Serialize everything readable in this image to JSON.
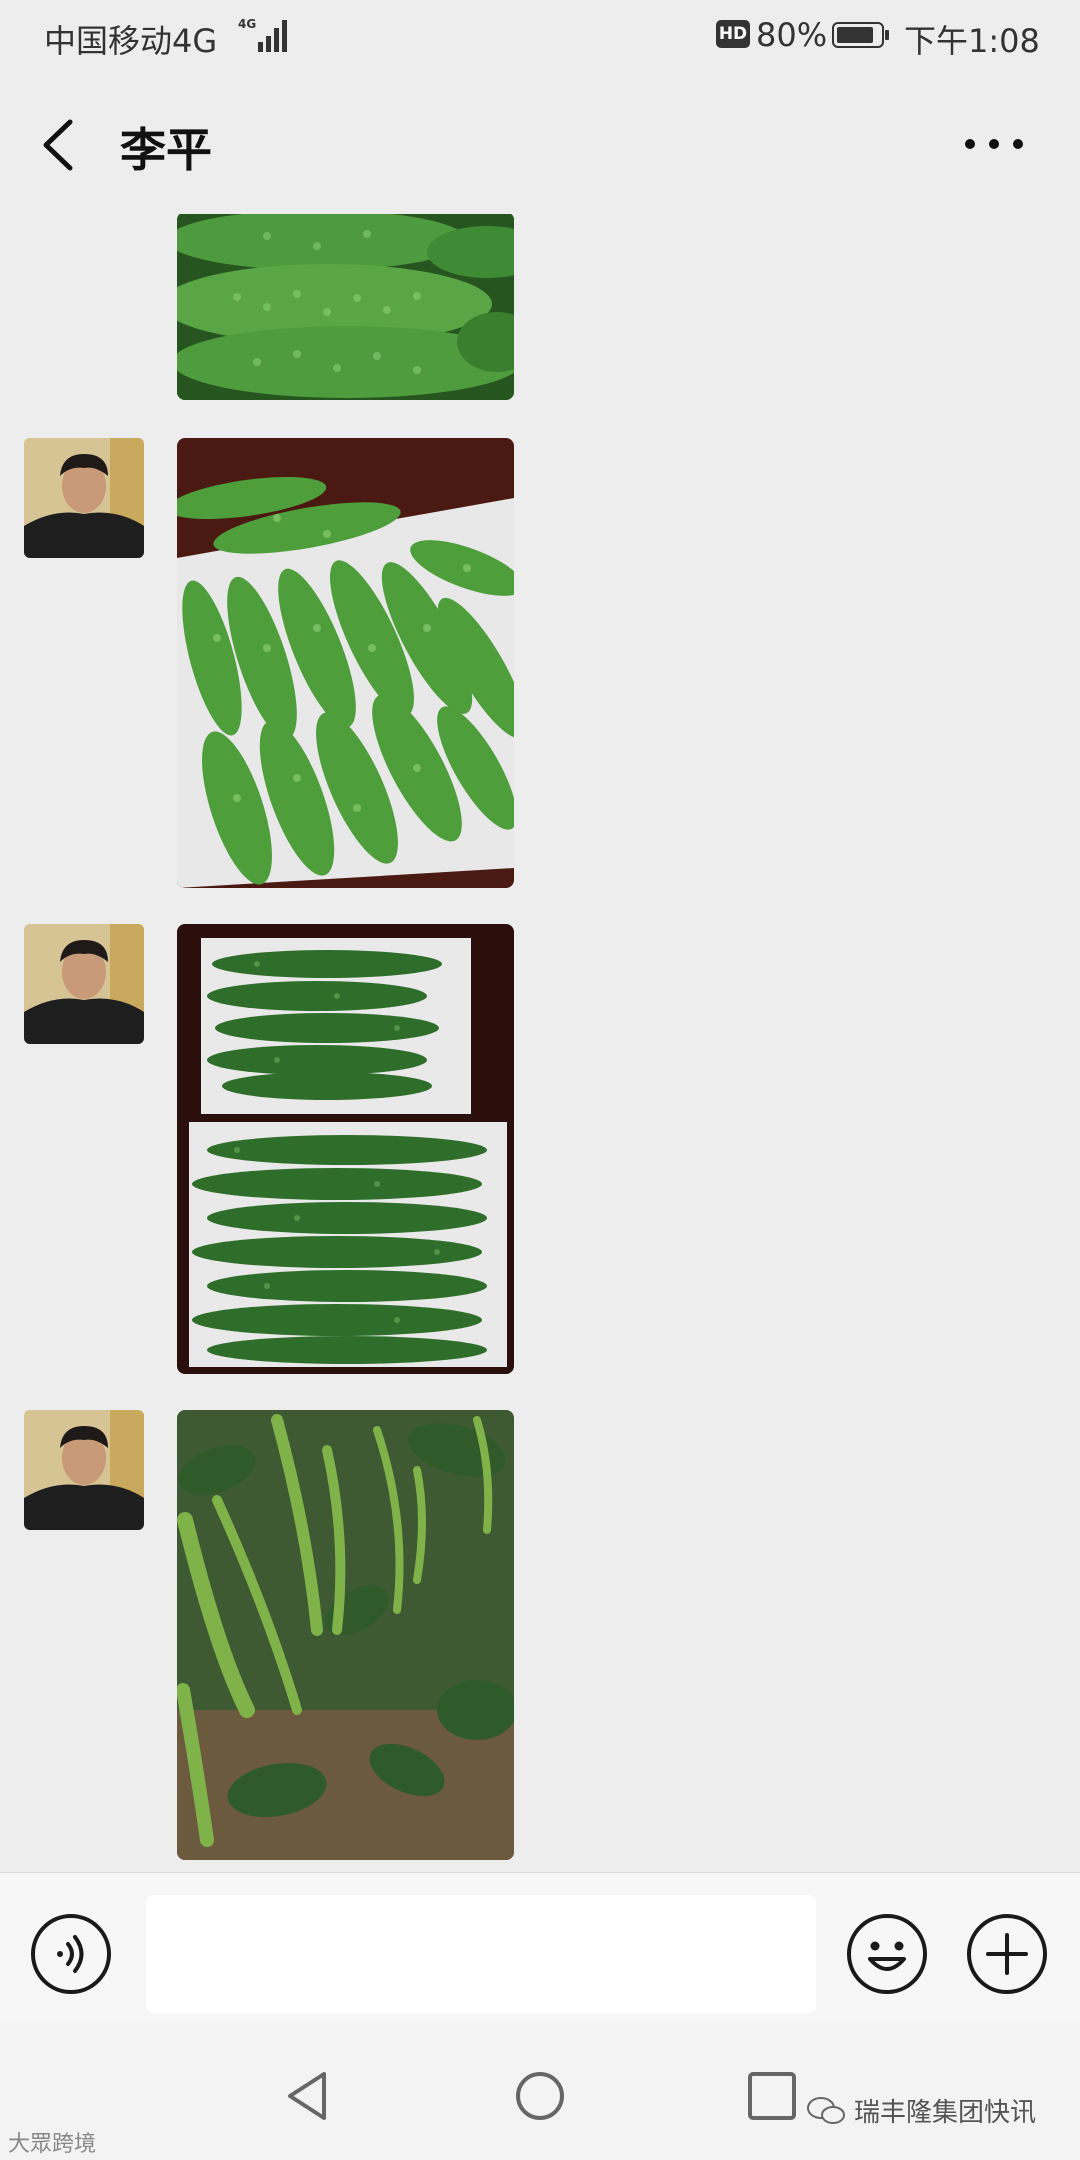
{
  "status_bar": {
    "carrier": "中国移动4G",
    "network_badge": "4G",
    "hd_badge": "HD",
    "battery_percent": "80%",
    "time": "下午1:08"
  },
  "nav": {
    "title": "李平"
  },
  "messages": [
    {
      "type": "image",
      "subject": "bitter melons"
    },
    {
      "type": "image",
      "subject": "bitter melons in white box"
    },
    {
      "type": "image",
      "subject": "bitter melons in two foam boxes"
    },
    {
      "type": "image",
      "subject": "green chili peppers on plants"
    }
  ],
  "input": {
    "placeholder": ""
  },
  "watermarks": {
    "right": "瑞丰隆集团快讯",
    "left": "大眾跨境"
  },
  "colors": {
    "background": "#ededed",
    "melon_green": "#3f9a3a",
    "icon": "#1a1a1a"
  }
}
